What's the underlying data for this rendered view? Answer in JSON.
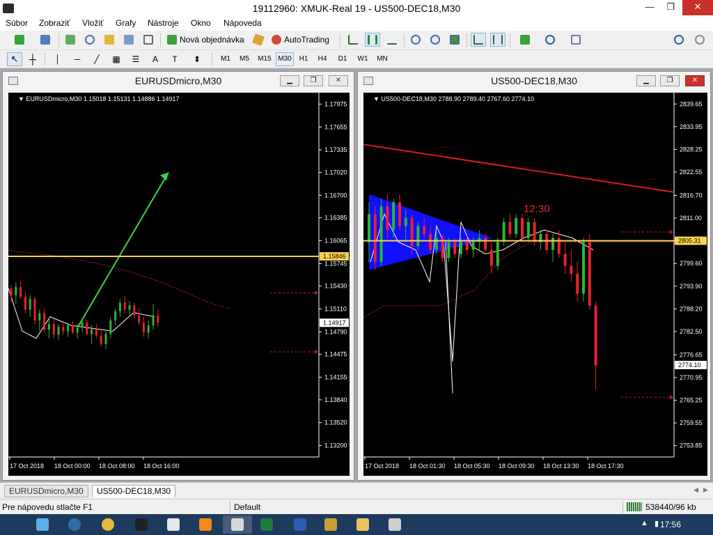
{
  "window": {
    "title": "19112960: XMUK-Real 19 - US500-DEC18,M30",
    "min_glyph": "—",
    "max_glyph": "❐",
    "close_glyph": "✕"
  },
  "menu": [
    "Súbor",
    "Zobraziť",
    "Vložiť",
    "Grafy",
    "Nástroje",
    "Okno",
    "Nápoveda"
  ],
  "toolbar": {
    "new_order": "Nová objednávka",
    "autotrading": "AutoTrading"
  },
  "timeframes": [
    "M1",
    "M5",
    "M15",
    "M30",
    "H1",
    "H4",
    "D1",
    "W1",
    "MN"
  ],
  "active_timeframe": "M30",
  "colors": {
    "up": "#2fb62f",
    "down": "#e8222a",
    "hline": "#ffd24d",
    "arrow": "#38d83a",
    "trend": "#e01a1a",
    "triangle": "#1010ff",
    "grid_text": "#ffffff",
    "dotted": "#c0202a"
  },
  "charts": [
    {
      "id": "eur",
      "window_title": "EURUSDmicro,M30",
      "info": "EURUSDmicro,M30  1.15018 1.15131 1.14886 1.14917",
      "price_labels": [
        "1.17975",
        "1.17655",
        "1.17335",
        "1.17020",
        "1.16700",
        "1.16385",
        "1.16065",
        "1.15745",
        "1.15430",
        "1.15110",
        "1.14790",
        "1.14475",
        "1.14155",
        "1.13840",
        "1.13520",
        "1.13200"
      ],
      "ymax": 1.18135,
      "ymin": 1.1304,
      "hline_price": 1.15846,
      "hline_label": "1.15846",
      "current_price": 1.14917,
      "current_label": "1.14917",
      "time_labels": [
        "17 Oct 2018",
        "18 Oct 00:00",
        "18 Oct 08:00",
        "18 Oct 16:00"
      ],
      "dotted_prices": [
        1.15335,
        1.1451
      ],
      "arrow": {
        "from": [
          1.1486
        ],
        "to": [
          1.1702
        ]
      },
      "candles": [
        [
          1.154,
          1.1545,
          1.152,
          1.153
        ],
        [
          1.153,
          1.1548,
          1.1518,
          1.1542
        ],
        [
          1.1542,
          1.155,
          1.1525,
          1.1528
        ],
        [
          1.1528,
          1.1535,
          1.1505,
          1.151
        ],
        [
          1.151,
          1.153,
          1.15,
          1.1525
        ],
        [
          1.1525,
          1.1528,
          1.149,
          1.1495
        ],
        [
          1.1495,
          1.151,
          1.148,
          1.1505
        ],
        [
          1.1505,
          1.1512,
          1.1478,
          1.1482
        ],
        [
          1.1482,
          1.1498,
          1.147,
          1.149
        ],
        [
          1.149,
          1.15,
          1.147,
          1.1475
        ],
        [
          1.1475,
          1.149,
          1.1468,
          1.1486
        ],
        [
          1.1486,
          1.1495,
          1.1475,
          1.148
        ],
        [
          1.148,
          1.1492,
          1.1472,
          1.1488
        ],
        [
          1.1488,
          1.1494,
          1.1476,
          1.1478
        ],
        [
          1.1478,
          1.149,
          1.147,
          1.1485
        ],
        [
          1.1485,
          1.1498,
          1.1478,
          1.1492
        ],
        [
          1.1492,
          1.1496,
          1.1474,
          1.1476
        ],
        [
          1.1476,
          1.1488,
          1.1462,
          1.1482
        ],
        [
          1.1482,
          1.149,
          1.147,
          1.1474
        ],
        [
          1.1474,
          1.1484,
          1.1458,
          1.1462
        ],
        [
          1.1462,
          1.148,
          1.1455,
          1.1476
        ],
        [
          1.1476,
          1.15,
          1.147,
          1.1495
        ],
        [
          1.1495,
          1.1512,
          1.1488,
          1.1508
        ],
        [
          1.1508,
          1.1525,
          1.15,
          1.152
        ],
        [
          1.152,
          1.153,
          1.1505,
          1.151
        ],
        [
          1.151,
          1.1522,
          1.1502,
          1.1516
        ],
        [
          1.1516,
          1.152,
          1.1498,
          1.1502
        ],
        [
          1.1502,
          1.1512,
          1.1488,
          1.1492
        ],
        [
          1.1492,
          1.15,
          1.1472,
          1.1478
        ],
        [
          1.1478,
          1.1495,
          1.147,
          1.1488
        ],
        [
          1.1488,
          1.1518,
          1.1482,
          1.1502
        ],
        [
          1.1502,
          1.151,
          1.1486,
          1.1492
        ]
      ]
    },
    {
      "id": "us",
      "window_title": "US500-DEC18,M30",
      "info": "US500-DEC18,M30  2788.90 2789.40 2767.60 2774.10",
      "price_labels": [
        "2839.65",
        "2833.95",
        "2828.25",
        "2822.55",
        "2816.70",
        "2811.00",
        "2805.31",
        "2799.60",
        "2793.90",
        "2788.20",
        "2782.50",
        "2776.65",
        "2770.95",
        "2765.25",
        "2759.55",
        "2753.85"
      ],
      "ymax": 2842.5,
      "ymin": 2751.0,
      "hline_price": 2805.31,
      "hline_label": "2805.31",
      "current_price": 2774.1,
      "current_label": "2774.10",
      "annotation": "12:30",
      "time_labels": [
        "17 Oct 2018",
        "18 Oct 01:30",
        "18 Oct 05:30",
        "18 Oct 09:30",
        "18 Oct 13:30",
        "18 Oct 17:30"
      ],
      "dotted_prices": [
        2807.5,
        2766.0
      ],
      "trend": {
        "from": 2829.5,
        "to": 2817.5
      },
      "triangle": {
        "top": 2817.0,
        "bottom": 2798.0,
        "apex": 2806.0
      },
      "candles": [
        [
          2805,
          2815,
          2800,
          2812
        ],
        [
          2812,
          2814,
          2798,
          2800
        ],
        [
          2800,
          2816,
          2799,
          2814
        ],
        [
          2814,
          2817,
          2806,
          2808
        ],
        [
          2808,
          2816,
          2806,
          2815
        ],
        [
          2815,
          2817,
          2808,
          2809
        ],
        [
          2809,
          2813,
          2805,
          2811
        ],
        [
          2811,
          2812,
          2802,
          2804
        ],
        [
          2804,
          2810,
          2803,
          2809
        ],
        [
          2809,
          2811,
          2806,
          2807
        ],
        [
          2807,
          2809,
          2802,
          2803
        ],
        [
          2803,
          2808,
          2802,
          2806
        ],
        [
          2806,
          2807,
          2800,
          2801
        ],
        [
          2801,
          2806,
          2800,
          2805
        ],
        [
          2805,
          2806,
          2801,
          2802
        ],
        [
          2802,
          2806,
          2801,
          2805
        ],
        [
          2805,
          2807,
          2802,
          2803
        ],
        [
          2803,
          2806,
          2801,
          2805
        ],
        [
          2805,
          2808,
          2803,
          2806
        ],
        [
          2806,
          2807,
          2802,
          2803
        ],
        [
          2803,
          2805,
          2797,
          2799
        ],
        [
          2799,
          2806,
          2798,
          2805
        ],
        [
          2805,
          2811,
          2804,
          2810
        ],
        [
          2810,
          2812,
          2806,
          2807
        ],
        [
          2807,
          2812,
          2806,
          2811
        ],
        [
          2811,
          2812,
          2805,
          2806
        ],
        [
          2806,
          2811,
          2805,
          2810
        ],
        [
          2810,
          2811,
          2804,
          2805
        ],
        [
          2805,
          2808,
          2803,
          2807
        ],
        [
          2807,
          2808,
          2802,
          2803
        ],
        [
          2803,
          2807,
          2800,
          2806
        ],
        [
          2806,
          2808,
          2801,
          2802
        ],
        [
          2802,
          2805,
          2797,
          2799
        ],
        [
          2799,
          2803,
          2795,
          2797
        ],
        [
          2797,
          2800,
          2790,
          2792
        ],
        [
          2792,
          2806,
          2790,
          2805
        ],
        [
          2805,
          2807,
          2788,
          2789
        ],
        [
          2789,
          2790,
          2768,
          2774
        ]
      ]
    }
  ],
  "tabs": [
    "EURUSDmicro,M30",
    "US500-DEC18,M30"
  ],
  "active_tab": 1,
  "status": {
    "help": "Pre nápovedu stlačte F1",
    "profile": "Default",
    "traffic": "538440/96 kb"
  },
  "taskbar": {
    "apps": [
      "start-icon",
      "file-manager-icon",
      "terminal-icon",
      "chrome-icon",
      "xm-icon",
      "excel-x-icon",
      "vlc-icon",
      "metatrader-icon",
      "excel-icon",
      "word-icon",
      "photos-icon",
      "folder-icon",
      "installer-icon"
    ],
    "clock": "17:56"
  }
}
